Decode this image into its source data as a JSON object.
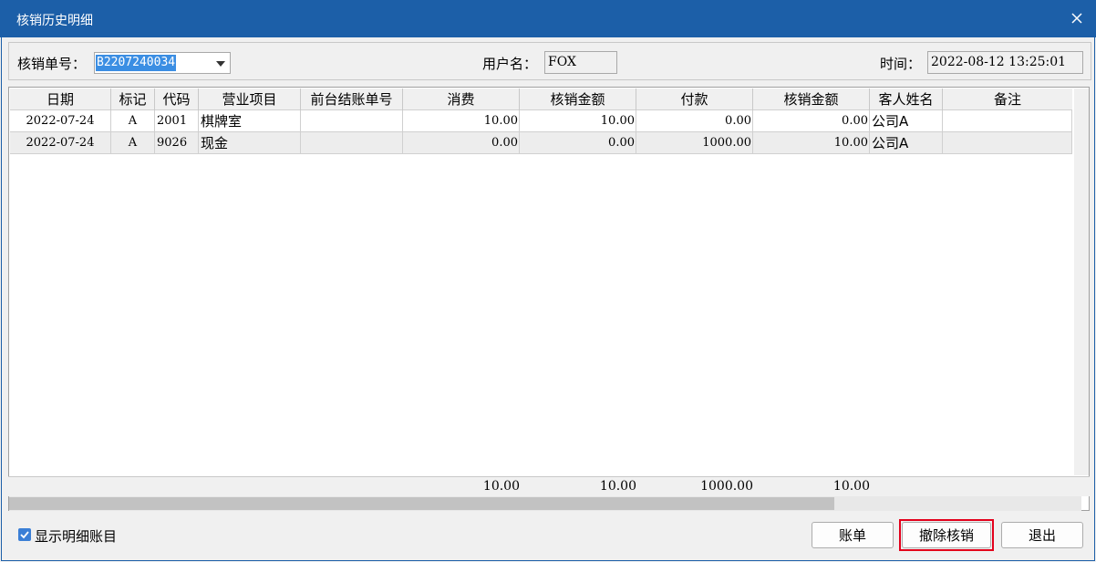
{
  "window": {
    "title": "核销历史明细"
  },
  "header": {
    "order_label": "核销单号：",
    "order_value": "B2207240034",
    "user_label": "用户名：",
    "user_value": "FOX",
    "time_label": "时间：",
    "time_value": "2022-08-12 13:25:01"
  },
  "grid": {
    "columns": [
      "日期",
      "标记",
      "代码",
      "营业项目",
      "前台结账单号",
      "消费",
      "核销金额",
      "付款",
      "核销金额",
      "客人姓名",
      "备注"
    ],
    "rows": [
      {
        "date": "2022-07-24",
        "mark": "A",
        "code": "2001",
        "item": "棋牌室",
        "front_bill": "",
        "consume": "10.00",
        "writeoff": "10.00",
        "payment": "0.00",
        "writeoff2": "0.00",
        "guest": "公司A",
        "remark": ""
      },
      {
        "date": "2022-07-24",
        "mark": "A",
        "code": "9026",
        "item": "现金",
        "front_bill": "",
        "consume": "0.00",
        "writeoff": "0.00",
        "payment": "1000.00",
        "writeoff2": "10.00",
        "guest": "公司A",
        "remark": ""
      }
    ],
    "totals": {
      "consume": "10.00",
      "writeoff": "10.00",
      "payment": "1000.00",
      "writeoff2": "10.00"
    }
  },
  "footer": {
    "show_detail_label": "显示明细账目",
    "show_detail_checked": true,
    "bill_button": "账单",
    "revoke_button": "撤除核销",
    "exit_button": "退出"
  },
  "colors": {
    "titlebar": "#1c5fa8",
    "selection": "#3b8ee3",
    "highlight": "#e3001b"
  },
  "icons": {
    "close": "close-icon",
    "dropdown": "chevron-down-icon",
    "checkbox": "checkmark-icon"
  }
}
